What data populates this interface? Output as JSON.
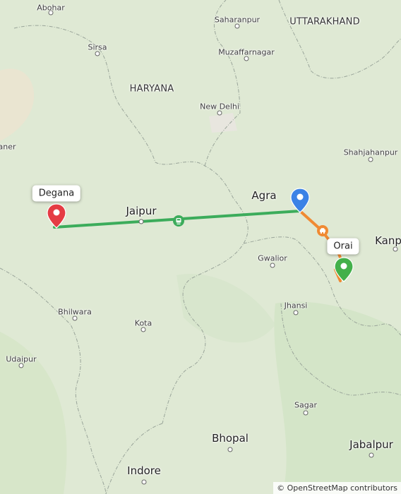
{
  "map": {
    "colors": {
      "land": "#dfe9d4",
      "border": "#9aa59a",
      "route_main": "#3cac5b",
      "route_secondary": "#f08a33",
      "marker_start": "#e53b44",
      "marker_mid": "#3b82e6",
      "marker_end": "#43b04a"
    },
    "places": {
      "abohar": "Abohar",
      "saharanpur": "Saharanpur",
      "uttarakhand": "UTTARAKHAND",
      "sirsa": "Sirsa",
      "muzaffarnagar": "Muzaffarnagar",
      "haryana": "HARYANA",
      "new_delhi": "New Delhi",
      "bikaner_partial": "aner",
      "shahjahanpur": "Shahjahanpur",
      "agra": "Agra",
      "jaipur": "Jaipur",
      "kanpur_partial": "Kanp",
      "gwalior": "Gwalior",
      "jhansi": "Jhansi",
      "bhilwara": "Bhilwara",
      "kota": "Kota",
      "udaipur": "Udaipur",
      "sagar": "Sagar",
      "bhopal": "Bhopal",
      "jabalpur": "Jabalpur",
      "indore": "Indore"
    },
    "markers": {
      "start_label": "Degana",
      "end_label": "Orai"
    },
    "route_icons": {
      "main": "train-icon",
      "secondary": "car-icon"
    },
    "attribution": "© OpenStreetMap contributors"
  }
}
